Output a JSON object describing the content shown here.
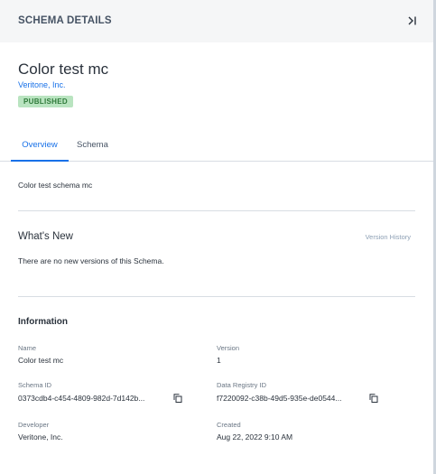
{
  "header": {
    "title": "SCHEMA DETAILS"
  },
  "schema": {
    "title": "Color test mc",
    "org": "Veritone, Inc.",
    "status": "PUBLISHED",
    "description": "Color test schema mc"
  },
  "tabs": [
    {
      "label": "Overview",
      "active": true
    },
    {
      "label": "Schema",
      "active": false
    }
  ],
  "whats_new": {
    "heading": "What's New",
    "version_history": "Version History",
    "message": "There are no new versions of this Schema."
  },
  "information": {
    "heading": "Information",
    "name_label": "Name",
    "name_value": "Color test mc",
    "version_label": "Version",
    "version_value": "1",
    "schema_id_label": "Schema ID",
    "schema_id_value": "0373cdb4-c454-4809-982d-7d142b...",
    "registry_id_label": "Data Registry ID",
    "registry_id_value": "f7220092-c38b-49d5-935e-de0544...",
    "developer_label": "Developer",
    "developer_value": "Veritone, Inc.",
    "created_label": "Created",
    "created_value": "Aug 22, 2022 9:10 AM"
  },
  "icons": {
    "collapse": "collapse-right-icon",
    "copy": "copy-icon"
  },
  "colors": {
    "accent": "#1871e8",
    "badge_bg": "#b9e4c0",
    "badge_text": "#2f7a3a",
    "header_bg": "#f5f6f7"
  }
}
